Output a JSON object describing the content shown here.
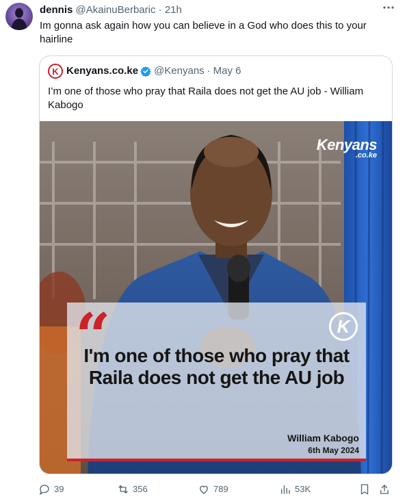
{
  "tweet": {
    "display_name": "dennis",
    "handle": "@AkainuBerbaric",
    "separator": "·",
    "time": "21h",
    "more_icon": "more-horizontal-icon",
    "text": "Im gonna ask again how you can believe in a God who does this to your hairline"
  },
  "quoted": {
    "logo_letter": "K",
    "display_name": "Kenyans.co.ke",
    "handle": "@Kenyans",
    "separator": "·",
    "date": "May 6",
    "text": "I’m one of those who pray that Raila does not get the AU job - William Kabogo",
    "image": {
      "brand_main": "Kenyans",
      "brand_sub": ".co.ke",
      "quote_mark": "“",
      "badge_letter": "K",
      "quote_text": "I'm one of those who pray that Raila does not get the AU job",
      "attribution_name": "William Kabogo",
      "attribution_date": "6th May 2024"
    }
  },
  "actions": {
    "replies": "39",
    "reposts": "356",
    "likes": "789",
    "views": "53K"
  },
  "colors": {
    "accent_red": "#cc2229",
    "verified_blue": "#1d9bf0",
    "muted_text": "#536471"
  }
}
